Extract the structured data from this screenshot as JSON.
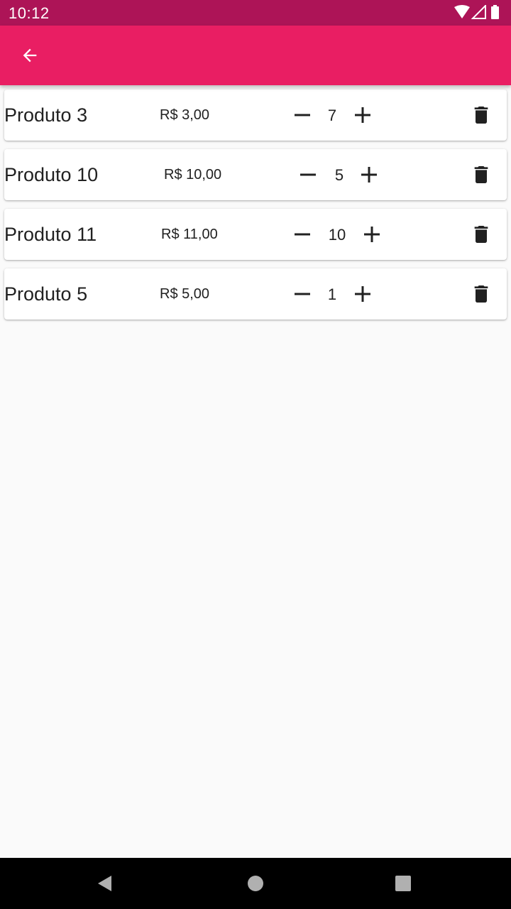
{
  "status_bar": {
    "time": "10:12",
    "icons": [
      "wifi-icon",
      "cell-signal-icon",
      "battery-icon"
    ],
    "background": "#ad1457"
  },
  "app_bar": {
    "background": "#e91e63",
    "back_icon": "arrow-back-icon"
  },
  "cart": {
    "items": [
      {
        "name": "Produto 3",
        "price": "R$ 3,00",
        "quantity": "7"
      },
      {
        "name": "Produto 10",
        "price": "R$ 10,00",
        "quantity": "5"
      },
      {
        "name": "Produto 11",
        "price": "R$ 11,00",
        "quantity": "10"
      },
      {
        "name": "Produto 5",
        "price": "R$ 5,00",
        "quantity": "1"
      }
    ],
    "decrement_icon": "minus-icon",
    "increment_icon": "plus-icon",
    "delete_icon": "trash-icon"
  },
  "nav_bar": {
    "buttons": [
      "back-triangle-icon",
      "home-circle-icon",
      "recents-square-icon"
    ]
  }
}
